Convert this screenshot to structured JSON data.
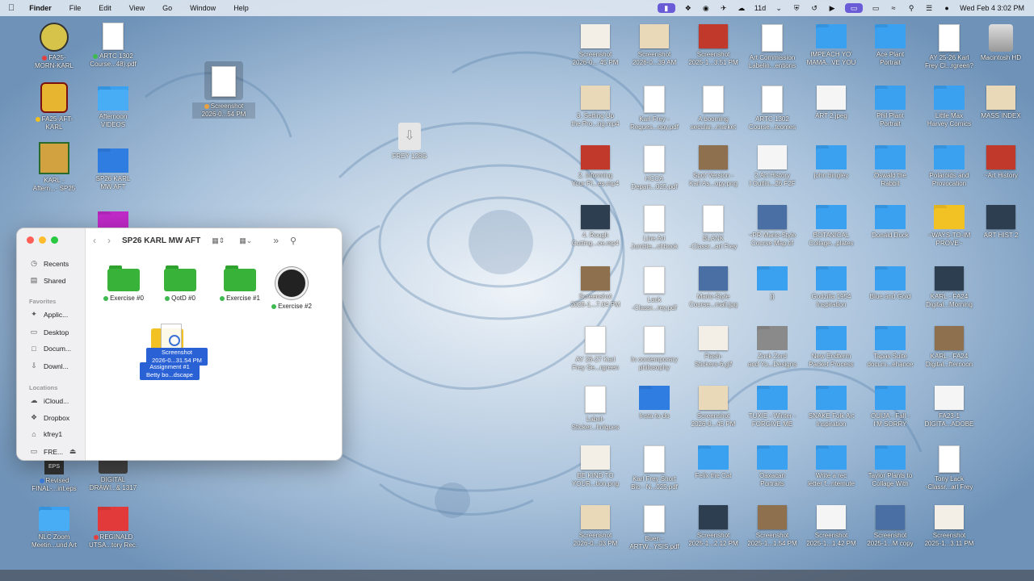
{
  "menubar": {
    "app": "Finder",
    "menus": [
      "File",
      "Edit",
      "View",
      "Go",
      "Window",
      "Help"
    ],
    "battery_label": "11d",
    "clock": "Wed Feb 4  3:02 PM"
  },
  "desktop_left": [
    {
      "label": "FA25-\nMORN-KARL",
      "dot": "#e34040"
    },
    {
      "label": "ARTC 1302\nCourse...48).pdf",
      "dot": "#3fb950"
    },
    {
      "label": "FA25-AFT-\nKARL",
      "dot": "#f0c020"
    },
    {
      "label": "Afternoon\nVIDEOS",
      "dot": ""
    },
    {
      "label": "KARL -\nAftern...- SP25",
      "dot": ""
    },
    {
      "label": "SP26 KARL\nMW AFT",
      "dot": ""
    },
    {
      "label": "Revised\nFINAL-...int.eps",
      "dot": "#3b7ddd"
    },
    {
      "label": "DIGITAL\nDRAWI...& 1317",
      "dot": ""
    },
    {
      "label": "NLC Zoom\nMeetin...und Art",
      "dot": ""
    },
    {
      "label": "REGINALD\nUTSA...tory Rec.",
      "dot": "#e34040"
    }
  ],
  "desktop_center": [
    {
      "label": "Screenshot\n2026-0...54 PM",
      "dot": "#e8a040"
    },
    {
      "label": "FREY 128G",
      "dot": ""
    }
  ],
  "desktop_right": [
    [
      "Screenshot\n2026-0... 45 PM",
      "Screenshot\n2026-0...39 AM",
      "Screenshot\n2025-1...3.51 PM",
      "Art Commission\nLabelin...entions",
      "IMPEACH YO'\nMAMA...VE YOU",
      "Ace Plant\nPortrait",
      "AY 25-26 Karl\nFrey Cl...rgreen?",
      "Macintosh HD"
    ],
    [
      "3. Setting Up\nthe Pro...ng.mp4",
      "Karl Frey -\nReques...opy.pdf",
      "A booming\nsecular...market",
      "ARTC 1302\nCourse...tcomes",
      "ART 2.jpeg",
      "Phil Plant\nPortrait",
      "Little Max\nHarvey Comics",
      "MASS INDEX"
    ],
    [
      "2. Informing\nYour Pl...es.mp4",
      "HCCA\nDepart...025.pdf",
      "Spot Version -\nKarl As...opy.png",
      "2.Art History\nI Outlin...26 F2F",
      "john bingley",
      "Oswald the\nRabbit",
      "Polaroids and\nProvocation",
      "~Art History"
    ],
    [
      "4. Rough\nCutting...ce.mp4",
      "Line Art\nJumble...chbook",
      "BLANK\n-Classr...arl Frey",
      "~PR Mario-Style\nCourse Map.tif",
      "BOTANICAL\nCollage...plates",
      "Donald Duck",
      "~WAYS-TO-IM\nPROVE~",
      "ART HIST 2"
    ],
    [
      "Screenshot\n2025-1...7.04 PM",
      "Lack\n-Classr...rey.pdf",
      "Mario-Style\nCourse...mall.jpg",
      "}}",
      "Godzilla 1954\nInspiration",
      "Blue and Gold",
      "KARL - FA24\nDigital...Morning"
    ],
    [
      "AY 26-27 Karl\nFrey Se...rgreen",
      "In contemporary\nphilosophy",
      "Flash-\nStickers-6.gif",
      "Zack Zord\nand Yu...Designs",
      "New Endterm\nPacket Process",
      "Tapas Suite\ndocum...ehance",
      "KARL - FA24\nDigital...fternoon"
    ],
    [
      "Label-\nSticker...hniques",
      "Insta to do",
      "Screenshot\n2026-0...45 PM",
      "TUXIE - Winter -\nFORGIVE ME",
      "SNAKE Folk Art\nInspiration",
      "OUIJA - Fall -\nI'M SORRY",
      "FA23-1\nDIGITA...ADOBE"
    ],
    [
      "BE KIND TO\nYOUR...tion.png",
      "Karl Frey Short\nBio - N...025.pdf",
      "Felix the Cat",
      "Oaxacan\nPortraits",
      "Write a rec\nletter f...ntemute",
      "Taylor Plants to\nCollage With",
      "Tony Lack\n-Classr...arl Frey"
    ],
    [
      "Screenshot\n2026-0...03 PM",
      "Buen -\nARTW...YSIS.pdf",
      "Screenshot\n2025-1...2.12 PM",
      "Screenshot\n2025-1...1.54 PM",
      "Screenshot\n2025-1...1.42 PM",
      "Screenshot\n2025-1...M copy",
      "Screenshot\n2025-1...3.11 PM"
    ]
  ],
  "finder": {
    "title": "SP26 KARL MW AFT",
    "sidebar": {
      "favorites_header": "Favorites",
      "locations_header": "Locations",
      "top_items": [
        "Recents",
        "Shared"
      ],
      "favorites": [
        "Applic...",
        "Desktop",
        "Docum...",
        "Downl..."
      ],
      "locations": [
        "iCloud...",
        "Dropbox",
        "kfrey1",
        "FRE..."
      ]
    },
    "items": [
      "Exercise #0",
      "QotD #0",
      "Exercise #1",
      "Exercise #2"
    ],
    "drag_labels": [
      "Screenshot\n2026-0...31.54 PM",
      "Assignment #1\nBetty bo...dscape"
    ]
  },
  "colors": {
    "folder_blue": "#3aa0f0",
    "folder_dark_blue": "#2f7de1",
    "folder_green": "#39b239",
    "folder_yellow": "#f2c224",
    "folder_red": "#e23a3a",
    "folder_magenta": "#c02ac8",
    "selection_blue": "#2a62d6"
  }
}
